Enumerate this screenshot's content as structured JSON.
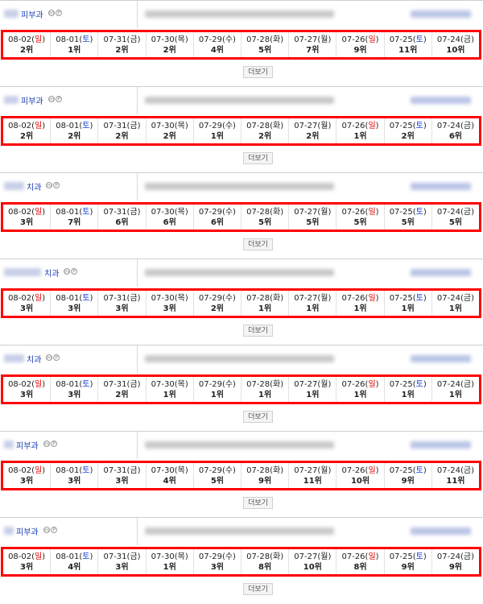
{
  "dates": [
    {
      "md": "08-02",
      "dow": "일",
      "type": "sun"
    },
    {
      "md": "08-01",
      "dow": "토",
      "type": "sat"
    },
    {
      "md": "07-31",
      "dow": "금",
      "type": "wd"
    },
    {
      "md": "07-30",
      "dow": "목",
      "type": "wd"
    },
    {
      "md": "07-29",
      "dow": "수",
      "type": "wd"
    },
    {
      "md": "07-28",
      "dow": "화",
      "type": "wd"
    },
    {
      "md": "07-27",
      "dow": "월",
      "type": "wd"
    },
    {
      "md": "07-26",
      "dow": "일",
      "type": "sun"
    },
    {
      "md": "07-25",
      "dow": "토",
      "type": "sat"
    },
    {
      "md": "07-24",
      "dow": "금",
      "type": "wd"
    }
  ],
  "more_label": "더보기",
  "badge_m": "m",
  "badge_p": "P",
  "colors": {
    "highlight": "#ff0000",
    "saturday": "#1a3fd6",
    "sunday": "#e00000",
    "category": "#1a3fb5"
  },
  "entries": [
    {
      "category": "피부과",
      "ranks": [
        "2위",
        "1위",
        "2위",
        "2위",
        "4위",
        "5위",
        "7위",
        "9위",
        "11위",
        "10위"
      ]
    },
    {
      "category": "피부과",
      "ranks": [
        "2위",
        "2위",
        "2위",
        "2위",
        "1위",
        "2위",
        "2위",
        "1위",
        "2위",
        "6위"
      ]
    },
    {
      "category": "치과",
      "ranks": [
        "3위",
        "7위",
        "6위",
        "6위",
        "6위",
        "5위",
        "5위",
        "5위",
        "5위",
        "5위"
      ]
    },
    {
      "category": "치과",
      "ranks": [
        "3위",
        "3위",
        "3위",
        "3위",
        "2위",
        "1위",
        "1위",
        "1위",
        "1위",
        "1위"
      ]
    },
    {
      "category": "치과",
      "ranks": [
        "3위",
        "3위",
        "2위",
        "1위",
        "1위",
        "1위",
        "1위",
        "1위",
        "1위",
        "1위"
      ]
    },
    {
      "category": "피부과",
      "ranks": [
        "3위",
        "3위",
        "3위",
        "4위",
        "5위",
        "9위",
        "11위",
        "10위",
        "9위",
        "11위"
      ]
    },
    {
      "category": "피부과",
      "ranks": [
        "3위",
        "4위",
        "3위",
        "1위",
        "3위",
        "8위",
        "10위",
        "8위",
        "9위",
        "9위"
      ]
    }
  ]
}
